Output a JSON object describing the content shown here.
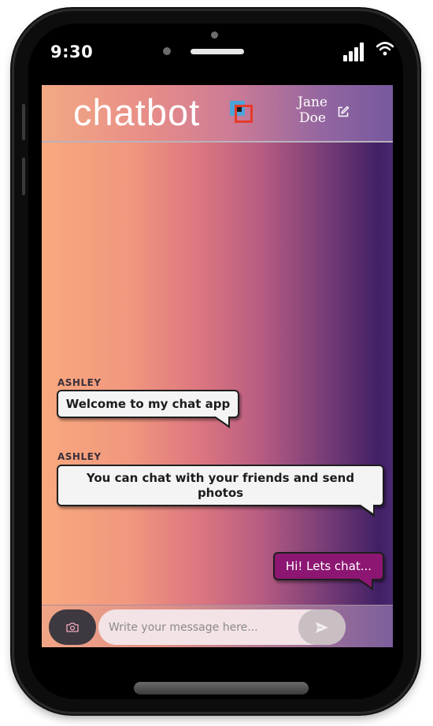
{
  "status_bar": {
    "time": "9:30"
  },
  "header": {
    "logo_text": "chatbot",
    "user_first_name": "Jane",
    "user_last_name": "Doe"
  },
  "messages": [
    {
      "sender": "ASHLEY",
      "text": "Welcome to my chat app"
    },
    {
      "sender": "ASHLEY",
      "text": "You can chat with your friends and send photos"
    },
    {
      "text": "Hi! Lets chat..."
    }
  ],
  "composer": {
    "placeholder": "Write your message here..."
  },
  "icons": {
    "edit": "edit-icon",
    "camera": "camera-icon",
    "send": "send-icon",
    "signal": "signal-icon",
    "wifi": "wifi-icon"
  },
  "colors": {
    "sent_bubble": "#8c1672",
    "received_bubble": "#f4f4f4",
    "camera_button": "#3e3940"
  }
}
